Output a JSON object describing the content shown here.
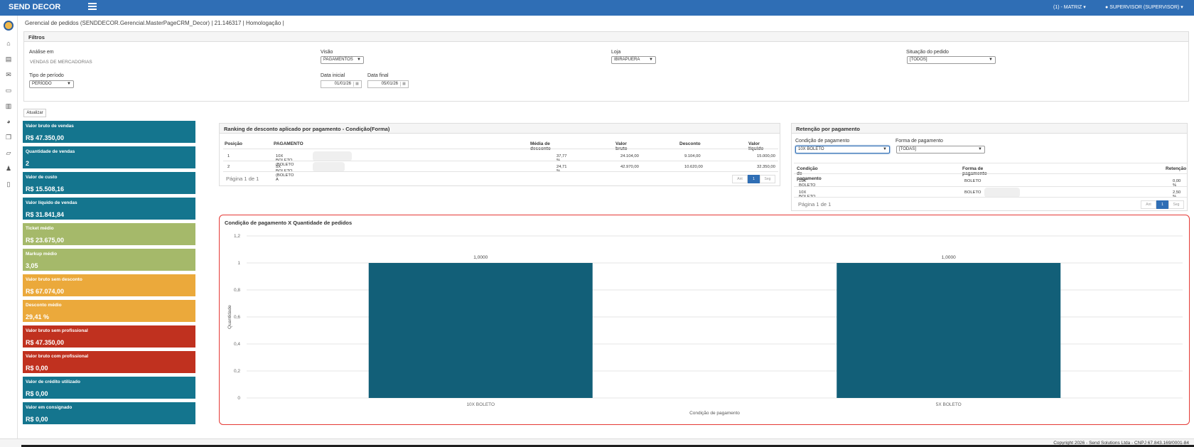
{
  "app": {
    "brand": "SEND DECOR",
    "branch": "(1) - MATRIZ",
    "user": "SUPERVISOR (SUPERVISOR)"
  },
  "page_title": "Gerencial de pedidos (SENDDECOR.Gerencial.MasterPageCRM_Decor) | 21.146317 | Homologação |",
  "filters": {
    "header": "Filtros",
    "analise_label": "Análise em",
    "analise_value": "VENDAS DE MERCADORIAS",
    "visao_label": "Visão",
    "visao_value": "PAGAMENTOS",
    "loja_label": "Loja",
    "loja_value": "IBIRAPUERA",
    "situacao_label": "Situação do pedido",
    "situacao_value": "[TODOS]",
    "tipo_label": "Tipo de período",
    "tipo_value": "PERÍODO",
    "data_inicial_label": "Data inicial",
    "data_inicial_value": "01/01/26",
    "data_final_label": "Data final",
    "data_final_value": "05/01/26"
  },
  "atualizar_label": "Atualizar",
  "kpis": [
    {
      "label": "Valor bruto de vendas",
      "value": "R$ 47.350,00",
      "color": "#14758e"
    },
    {
      "label": "Quantidade de vendas",
      "value": "2",
      "color": "#14758e"
    },
    {
      "label": "Valor de custo",
      "value": "R$ 15.508,16",
      "color": "#14758e"
    },
    {
      "label": "Valor líquido de vendas",
      "value": "R$ 31.841,84",
      "color": "#14758e"
    },
    {
      "label": "Ticket médio",
      "value": "R$ 23.675,00",
      "color": "#a5b96a"
    },
    {
      "label": "Markup médio",
      "value": "3,05",
      "color": "#a5b96a"
    },
    {
      "label": "Valor bruto sem desconto",
      "value": "R$ 67.074,00",
      "color": "#eba93b"
    },
    {
      "label": "Desconto médio",
      "value": "29,41 %",
      "color": "#eba93b"
    },
    {
      "label": "Valor bruto sem profissional",
      "value": "R$ 47.350,00",
      "color": "#c0311f"
    },
    {
      "label": "Valor bruto com profissional",
      "value": "R$ 0,00",
      "color": "#c0311f"
    },
    {
      "label": "Valor de crédito utilizado",
      "value": "R$ 0,00",
      "color": "#14758e"
    },
    {
      "label": "Valor em consignado",
      "value": "R$ 0,00",
      "color": "#14758e"
    }
  ],
  "ranking": {
    "title": "Ranking de desconto aplicado por pagamento - Condição(Forma)",
    "headers": [
      "Posição",
      "PAGAMENTO",
      "Média de desconto",
      "Valor bruto",
      "Desconto",
      "Valor líquido"
    ],
    "rows": [
      [
        "1",
        "10X BOLETO (BOLETO",
        "37,77 %",
        "24.104,00",
        "9.104,00",
        "15.000,00"
      ],
      [
        "2",
        "5X BOLETO (BOLETO A",
        "24,71 %",
        "42.970,00",
        "10.620,00",
        "32.350,00"
      ]
    ],
    "pager": "Página 1 de 1",
    "prev": "Ant",
    "page": "1",
    "next": "Seg"
  },
  "retencao": {
    "title": "Retenção por pagamento",
    "cond_label": "Condição de pagamento",
    "cond_value": "10X BOLETO",
    "forma_label": "Forma de pagamento",
    "forma_value": "[TODAS]",
    "headers": [
      "Condição de pagamento",
      "Forma de pagamento",
      "Retenção"
    ],
    "rows": [
      [
        "10X BOLETO",
        "BOLETO",
        "0,00 %"
      ],
      [
        "10X BOLETO",
        "BOLETO",
        "2,50 %"
      ]
    ],
    "pager": "Página 1 de 1",
    "prev": "Ant",
    "page": "1",
    "next": "Seg"
  },
  "chart_data": {
    "type": "bar",
    "title": "Condição de pagamento X Quantidade de pedidos",
    "categories": [
      "10X BOLETO",
      "5X BOLETO"
    ],
    "values": [
      1,
      1
    ],
    "value_labels": [
      "1,0000",
      "1,0000"
    ],
    "ylim": [
      0,
      1.2
    ],
    "yticks": [
      "0",
      "0,2",
      "0,4",
      "0,6",
      "0,8",
      "1",
      "1,2"
    ],
    "xlabel": "Condição de pagamento",
    "ylabel": "Quantidade",
    "bar_color": "#125f78",
    "grid": true,
    "legend": "none"
  },
  "footer": "Copyright 2026 - Send Solutions Ltda - CNPJ 67.843.169/0001-84"
}
